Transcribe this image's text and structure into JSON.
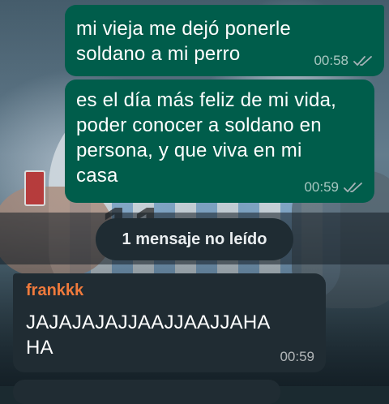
{
  "messages": [
    {
      "direction": "outgoing",
      "text_lines": [
        "mi vieja me dejó ponerle",
        "soldano a mi perro"
      ],
      "time": "00:58",
      "status_icon": "double-check-icon"
    },
    {
      "direction": "outgoing",
      "text_lines": [
        "es el día más feliz de mi vida,",
        "poder conocer a soldano en",
        "persona, y que viva en mi",
        "casa"
      ],
      "time": "00:59",
      "status_icon": "double-check-icon"
    },
    {
      "direction": "incoming",
      "sender": "frankkk",
      "text_lines": [
        "JAJAJAJAJJAAJJAAJJAHA",
        "HA"
      ],
      "time": "00:59"
    }
  ],
  "unread_divider": {
    "label": "1 mensaje no leído"
  },
  "colors": {
    "outgoing_bubble": "#005d4b",
    "incoming_bubble": "#202c33",
    "sender_name": "#f07a3c",
    "meta_text": "#a6b3b8"
  }
}
